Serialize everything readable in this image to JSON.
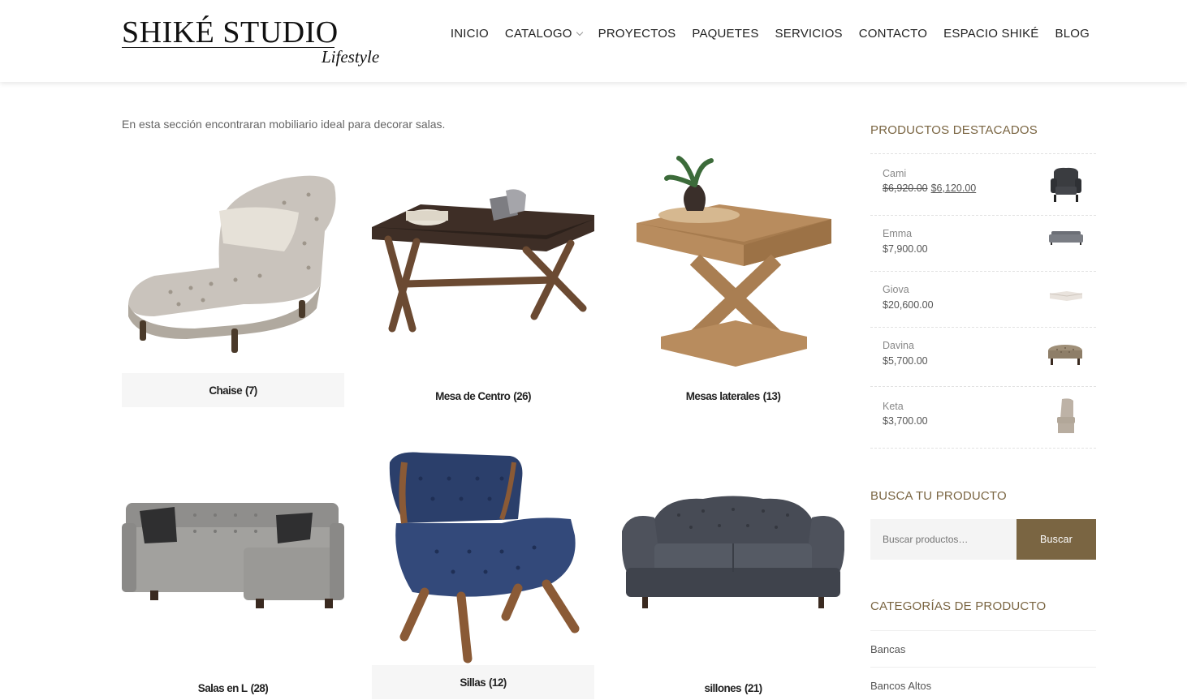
{
  "brand": {
    "name": "SHIKÉ STUDIO",
    "tagline": "Lifestyle"
  },
  "nav": [
    {
      "label": "INICIO"
    },
    {
      "label": "CATALOGO",
      "has_dropdown": true
    },
    {
      "label": "PROYECTOS"
    },
    {
      "label": "PAQUETES"
    },
    {
      "label": "SERVICIOS"
    },
    {
      "label": "CONTACTO"
    },
    {
      "label": "ESPACIO SHIKÉ"
    },
    {
      "label": "BLOG"
    }
  ],
  "main": {
    "intro": "En esta sección encontraran mobiliario ideal para decorar salas.",
    "categories": [
      {
        "name": "Chaise",
        "count": "(7)",
        "icon": "chaise-longue-image"
      },
      {
        "name": "Mesa de Centro",
        "count": "(26)",
        "icon": "coffee-table-image"
      },
      {
        "name": "Mesas laterales",
        "count": "(13)",
        "icon": "side-table-image"
      },
      {
        "name": "Salas en L",
        "count": "(28)",
        "icon": "sectional-sofa-image"
      },
      {
        "name": "Sillas",
        "count": "(12)",
        "icon": "accent-chair-image"
      },
      {
        "name": "sillones",
        "count": "(21)",
        "icon": "sofa-image"
      }
    ]
  },
  "sidebar": {
    "featured_title": "PRODUCTOS DESTACADOS",
    "featured": [
      {
        "name": "Cami",
        "old_price": "$6,920.00",
        "price": "$6,120.00",
        "icon": "wingback-chair-thumb"
      },
      {
        "name": "Emma",
        "price": "$7,900.00",
        "icon": "sofa-thumb"
      },
      {
        "name": "Giova",
        "price": "$20,600.00",
        "icon": "sectional-thumb"
      },
      {
        "name": "Davina",
        "price": "$5,700.00",
        "icon": "ottoman-thumb"
      },
      {
        "name": "Keta",
        "price": "$3,700.00",
        "icon": "dining-chair-thumb"
      }
    ],
    "search_title": "BUSCA TU PRODUCTO",
    "search_placeholder": "Buscar productos…",
    "search_button": "Buscar",
    "categories_title": "CATEGORÍAS DE PRODUCTO",
    "categories": [
      {
        "label": "Bancas"
      },
      {
        "label": "Bancos Altos"
      }
    ]
  },
  "colors": {
    "accent": "#7a6542",
    "text": "#555555",
    "caption_bg": "#f6f6f6"
  }
}
